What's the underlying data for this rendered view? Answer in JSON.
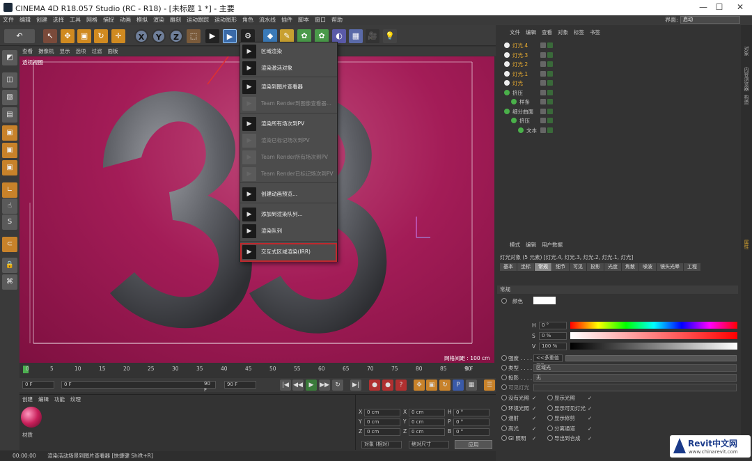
{
  "window": {
    "title": "CINEMA 4D R18.057 Studio (RC - R18) - [未标题 1 *] - 主要",
    "layout_label": "界面:",
    "layout_value": "启动"
  },
  "menubar": [
    "文件",
    "编辑",
    "创建",
    "选择",
    "工具",
    "网格",
    "捕捉",
    "动画",
    "模拟",
    "渲染",
    "雕刻",
    "运动跟踪",
    "运动图形",
    "角色",
    "流水线",
    "插件",
    "脚本",
    "窗口",
    "帮助"
  ],
  "viewport": {
    "menu": [
      "查看",
      "摄像机",
      "显示",
      "选项",
      "过滤",
      "面板"
    ],
    "label": "透视视图",
    "grid_label": "网格间距 : 100 cm",
    "scene_text": "33"
  },
  "render_menu": {
    "items": [
      {
        "label": "区域渲染",
        "enabled": true
      },
      {
        "label": "渲染激活对象",
        "enabled": true
      },
      {
        "label": "渲染到图片查看器",
        "enabled": true
      },
      {
        "label": "Team Render到图像查看器...",
        "enabled": false
      },
      {
        "label": "渲染所有场次到PV",
        "enabled": true
      },
      {
        "label": "渲染已标记场次到PV",
        "enabled": false
      },
      {
        "label": "Team Render所有场次到PV",
        "enabled": false
      },
      {
        "label": "Team Render已标记场次到PV",
        "enabled": false
      },
      {
        "label": "创建动画预览...",
        "enabled": true
      },
      {
        "label": "添加到渲染队列...",
        "enabled": true
      },
      {
        "label": "渲染队列",
        "enabled": true
      },
      {
        "label": "交互式区域渲染(IRR)",
        "enabled": true,
        "highlighted": true
      }
    ]
  },
  "timeline": {
    "ticks": [
      "0",
      "5",
      "10",
      "15",
      "20",
      "25",
      "30",
      "35",
      "40",
      "45",
      "50",
      "55",
      "60",
      "65",
      "70",
      "75",
      "80",
      "85",
      "90"
    ],
    "end_frame": "0 F",
    "start_field": "0 F",
    "min_field": "0 F",
    "max_field": "90 F",
    "end_field": "90 F"
  },
  "materials": {
    "menu": [
      "创建",
      "编辑",
      "功能",
      "纹理"
    ],
    "material_name": "材质"
  },
  "coordinates": {
    "rows": [
      {
        "a": "X",
        "av": "0 cm",
        "b": "X",
        "bv": "0 cm",
        "c": "H",
        "cv": "0 °"
      },
      {
        "a": "Y",
        "av": "0 cm",
        "b": "Y",
        "bv": "0 cm",
        "c": "P",
        "cv": "0 °"
      },
      {
        "a": "Z",
        "av": "0 cm",
        "b": "Z",
        "bv": "0 cm",
        "c": "B",
        "cv": "0 °"
      }
    ],
    "mode": "对象 (相对)",
    "size_mode": "绝对尺寸",
    "apply": "应用"
  },
  "status_bar": {
    "time": "00:00:00",
    "message": "渲染活动场景到图片查看器 [快捷键 Shift+R]"
  },
  "objects": {
    "menu": [
      "文件",
      "编辑",
      "查看",
      "对象",
      "标签",
      "书签"
    ],
    "rows": [
      {
        "name": "灯光.4",
        "color": "#f0b030"
      },
      {
        "name": "灯光.3",
        "color": "#f0b030"
      },
      {
        "name": "灯光.2",
        "color": "#f0b030"
      },
      {
        "name": "灯光.1",
        "color": "#f0b030"
      },
      {
        "name": "灯光",
        "color": "#f0b030"
      },
      {
        "name": "挤压",
        "color": "#c8c8c8"
      },
      {
        "name": "样条",
        "color": "#c8c8c8"
      },
      {
        "name": "细分曲面",
        "color": "#c8c8c8"
      },
      {
        "name": "挤压",
        "color": "#c8c8c8"
      },
      {
        "name": "文本",
        "color": "#c8c8c8"
      }
    ]
  },
  "attributes": {
    "menu": [
      "模式",
      "编辑",
      "用户数据"
    ],
    "header": "灯光对象 (5 元素) [灯光.4, 灯光.3, 灯光.2, 灯光.1, 灯光]",
    "tabs": [
      "基本",
      "坐标",
      "常规",
      "细节",
      "可见",
      "投影",
      "光度",
      "焦散",
      "噪波",
      "镜头光晕",
      "工程"
    ],
    "selected_tab": "常规",
    "section": "常规",
    "color_label": "颜色",
    "h_label": "H",
    "h_value": "0 °",
    "s_label": "S",
    "s_value": "0 %",
    "v_label": "V",
    "v_value": "100 %",
    "intensity_label": "强度 . . . . .",
    "intensity_value": "<<多重值>>",
    "type_label": "类型 . . . . .",
    "type_value": "区域光",
    "shadow_label": "投影 . . . . .",
    "shadow_value": "无",
    "visible_light_label": "可见灯光",
    "checks": [
      {
        "l": "没有光照",
        "r": "显示光照"
      },
      {
        "l": "环境光照",
        "r": "显示可见灯光"
      },
      {
        "l": "漫射",
        "r": "显示修剪"
      },
      {
        "l": "高光",
        "r": "分离通道"
      },
      {
        "l": "GI 照明",
        "r": "导出到合成"
      }
    ]
  },
  "side_tabs": [
    "对象",
    "内容浏览器",
    "构造"
  ],
  "attr_side_tab": "属性",
  "watermark": {
    "brand": "Revit中文网",
    "url": "www.chinarevit.com"
  },
  "colors": {
    "highlight": "#c0282d",
    "viewport_bg": "#a31c57",
    "accent": "#f0b030"
  }
}
